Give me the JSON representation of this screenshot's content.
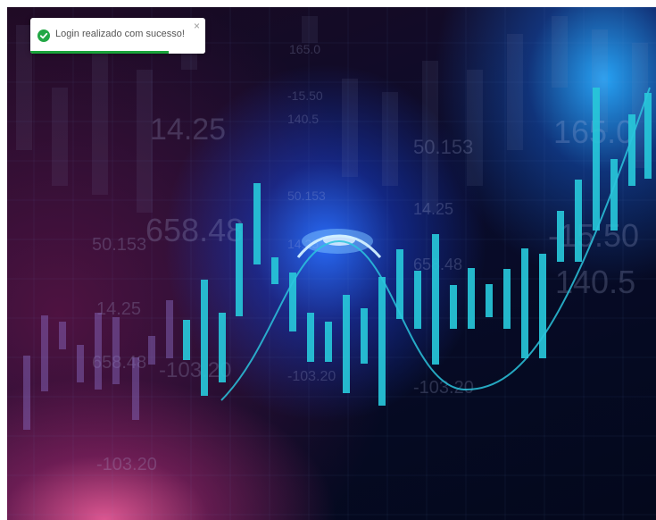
{
  "toast": {
    "message": "Login realizado com sucesso!",
    "close_glyph": "×",
    "status_icon": "check-circle-icon",
    "progress": 0.79,
    "color": "#22a745"
  },
  "background": {
    "numbers": [
      "165.0",
      "-15.50",
      "140.5",
      "14.25",
      "50.153",
      "658.48",
      "50.153",
      "14.25",
      "658.48",
      "-103.20",
      "-103.20",
      "14.25",
      "-103.20",
      "658.48",
      "-103.20",
      "165.0",
      "-15.50",
      "140.5",
      "14.25",
      "50.153",
      "-103.20"
    ],
    "colors": {
      "bar": "#27c7d9",
      "curve": "#2bc4dd",
      "glow": "#3a78ff",
      "pink": "#e65a96"
    }
  }
}
